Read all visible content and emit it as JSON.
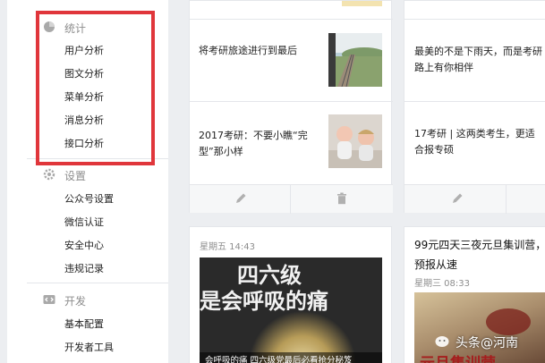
{
  "sidebar": {
    "sections": [
      {
        "title": "统计",
        "icon": "pie-chart-icon",
        "items": [
          "用户分析",
          "图文分析",
          "菜单分析",
          "消息分析",
          "接口分析"
        ]
      },
      {
        "title": "设置",
        "icon": "gear-icon",
        "items": [
          "公众号设置",
          "微信认证",
          "安全中心",
          "违规记录"
        ]
      },
      {
        "title": "开发",
        "icon": "code-icon",
        "items": [
          "基本配置",
          "开发者工具"
        ]
      }
    ]
  },
  "columns": [
    {
      "rows": [
        {
          "text": "将考研旅途进行到最后",
          "thumb": "train-track-photo"
        },
        {
          "text": "2017考研：不要小瞧“完型”那小样",
          "thumb": "toddlers-photo"
        }
      ],
      "actions": [
        "pencil-icon",
        "trash-icon"
      ]
    },
    {
      "rows": [
        {
          "text": "最美的不是下雨天，而是考研路上有你相伴"
        },
        {
          "text": "17考研 | 这两类考生，更适合报专硕"
        }
      ],
      "actions": [
        "pencil-icon"
      ]
    }
  ],
  "cards": [
    {
      "time": "星期五 14:43",
      "cover_title_line1": "四六级",
      "cover_title_line2": "是会呼吸的痛",
      "caption": "会呼吸的痛 四六级党最后必看抢分秘笈"
    },
    {
      "title": "99元四天三夜元旦集训营，预报从速",
      "time": "星期三 08:33",
      "cover_text": "元旦集训营"
    }
  ],
  "watermark": "头条@河南",
  "colors": {
    "highlight": "#e0363b",
    "panel": "#ffffff",
    "border": "#e4e6ea"
  }
}
